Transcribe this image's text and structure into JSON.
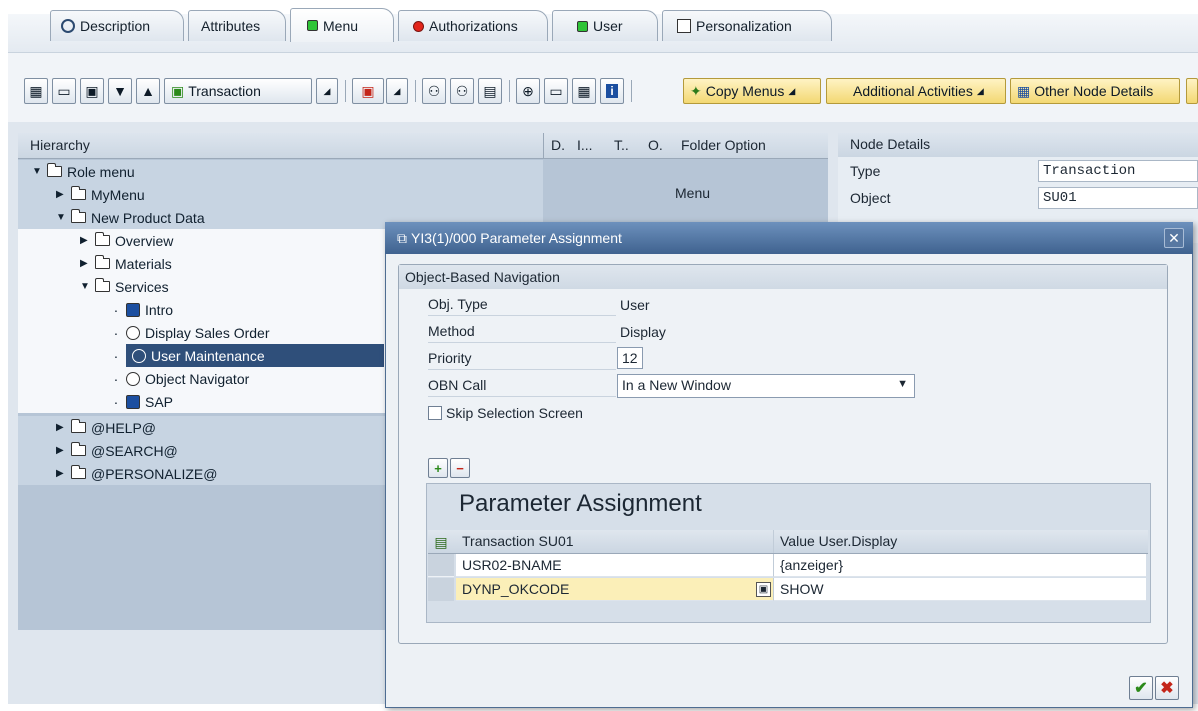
{
  "tabs": [
    {
      "label": "Description",
      "icon": "magnifier-icon"
    },
    {
      "label": "Attributes",
      "icon": ""
    },
    {
      "label": "Menu",
      "icon": "green-square-icon"
    },
    {
      "label": "Authorizations",
      "icon": "red-traffic-icon"
    },
    {
      "label": "User",
      "icon": "green-square-icon"
    },
    {
      "label": "Personalization",
      "icon": "personalization-icon"
    }
  ],
  "toolbar": {
    "transaction": "Transaction",
    "copy_menus": "Copy Menus",
    "additional_activities": "Additional Activities",
    "other_node_details": "Other Node Details"
  },
  "hierarchy": {
    "headers": {
      "hierarchy": "Hierarchy",
      "d": "D.",
      "i": "I...",
      "t": "T..",
      "o": "O.",
      "folder_option": "Folder Option"
    },
    "menu_label": "Menu",
    "rows": [
      {
        "label": "Role menu"
      },
      {
        "label": "MyMenu"
      },
      {
        "label": "New Product Data"
      },
      {
        "label": "Overview"
      },
      {
        "label": "Materials"
      },
      {
        "label": "Services"
      },
      {
        "label": "Intro"
      },
      {
        "label": "Display Sales Order"
      },
      {
        "label": "User Maintenance"
      },
      {
        "label": "Object Navigator"
      },
      {
        "label": "SAP"
      },
      {
        "label": "@HELP@"
      },
      {
        "label": "@SEARCH@"
      },
      {
        "label": "@PERSONALIZE@"
      }
    ]
  },
  "node_details": {
    "title": "Node Details",
    "type_label": "Type",
    "type_value": "Transaction",
    "object_label": "Object",
    "object_value": "SU01"
  },
  "dialog": {
    "title": "YI3(1)/000 Parameter Assignment",
    "group_title": "Object-Based Navigation",
    "obj_type_label": "Obj. Type",
    "obj_type_value": "User",
    "method_label": "Method",
    "method_value": "Display",
    "priority_label": "Priority",
    "priority_value": "12",
    "obn_call_label": "OBN Call",
    "obn_call_value": "In a New Window",
    "skip_label": "Skip Selection Screen",
    "param_title": "Parameter Assignment",
    "col1": "Transaction SU01",
    "col2": "Value User.Display",
    "rows": [
      {
        "param": "USR02-BNAME",
        "value": "{anzeiger}"
      },
      {
        "param": "DYNP_OKCODE",
        "value": "SHOW"
      }
    ]
  }
}
